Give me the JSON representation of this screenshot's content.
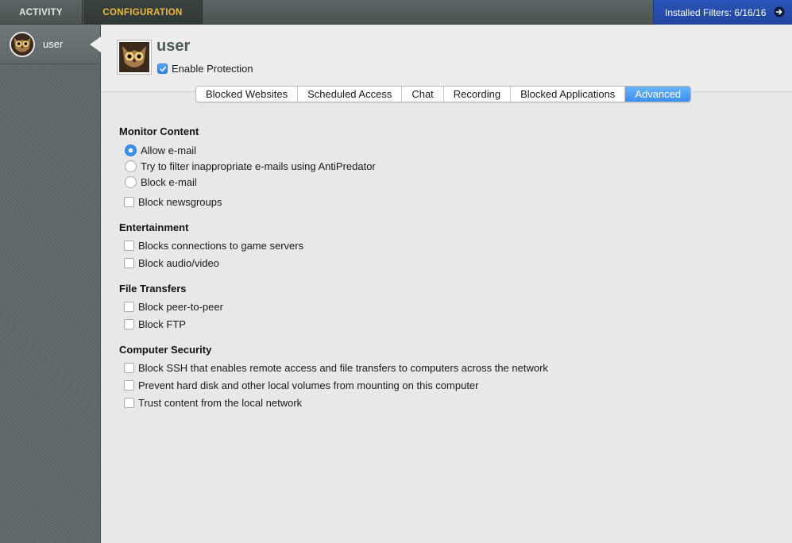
{
  "topbar": {
    "tabs": [
      {
        "label": "ACTIVITY"
      },
      {
        "label": "CONFIGURATION"
      }
    ],
    "installed_filters": "Installed Filters: 6/16/16"
  },
  "sidebar": {
    "user_label": "user"
  },
  "header": {
    "user_name": "user",
    "enable_protection": "Enable Protection"
  },
  "tabs": [
    {
      "label": "Blocked Websites"
    },
    {
      "label": "Scheduled Access"
    },
    {
      "label": "Chat"
    },
    {
      "label": "Recording"
    },
    {
      "label": "Blocked Applications"
    },
    {
      "label": "Advanced"
    }
  ],
  "sections": {
    "monitor_content": {
      "title": "Monitor Content",
      "options": [
        "Allow e-mail",
        "Try to filter inappropriate e-mails using AntiPredator",
        "Block e-mail",
        "Block newsgroups"
      ]
    },
    "entertainment": {
      "title": "Entertainment",
      "options": [
        "Blocks connections to game servers",
        "Block audio/video"
      ]
    },
    "file_transfers": {
      "title": "File Transfers",
      "options": [
        "Block peer-to-peer",
        "Block FTP"
      ]
    },
    "computer_security": {
      "title": "Computer Security",
      "options": [
        "Block SSH that enables remote access and file transfers to computers across the network",
        "Prevent hard disk and other local volumes from mounting on this computer",
        "Trust content from the local network"
      ]
    }
  },
  "colors": {
    "accent_blue": "#3b8ff0",
    "config_tab_text": "#f0b93a",
    "installed_bg": "#2b55b8"
  }
}
